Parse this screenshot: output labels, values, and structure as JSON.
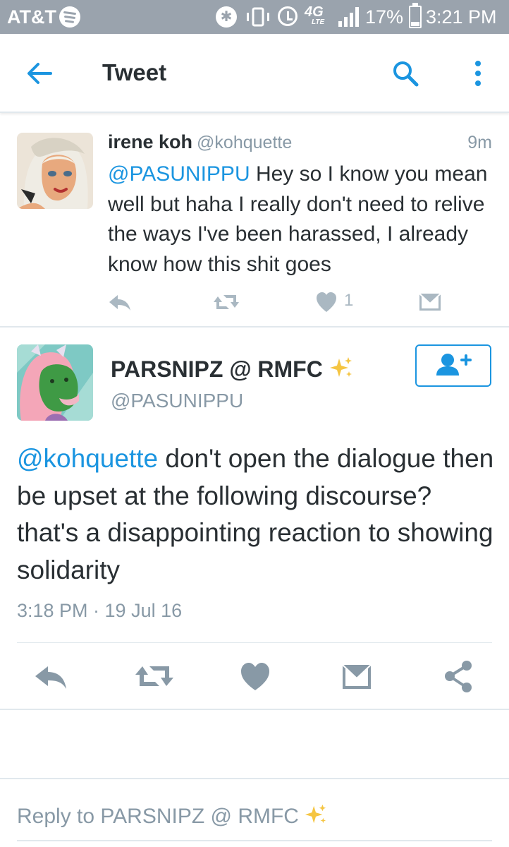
{
  "status_bar": {
    "carrier": "AT&T",
    "battery_percent": "17%",
    "time": "3:21 PM",
    "network": "4G",
    "network_sub": "LTE",
    "bluetooth_glyph": "✱"
  },
  "app_bar": {
    "title": "Tweet",
    "back_icon": "arrow-left-icon",
    "search_icon": "search-icon",
    "more_icon": "more-vertical-icon"
  },
  "reply_tweet": {
    "display_name": "irene koh",
    "handle": "@kohquette",
    "age": "9m",
    "mention": "@PASUNIPPU",
    "text": " Hey so I know you mean well but haha I really don't need to relive the ways I've been harassed, I already know how this shit goes",
    "like_count": "1"
  },
  "main_tweet": {
    "display_name": "PARSNIPZ @ RMFC",
    "handle": "@PASUNIPPU",
    "mention": "@kohquette",
    "text": " don't open the dialogue then be upset at the following discourse? that's a disappointing reaction to showing solidarity",
    "timestamp": "3:18 PM · 19 Jul 16",
    "follow_icon": "follow-user-icon"
  },
  "composer": {
    "placeholder": "Reply to PARSNIPZ @ RMFC"
  },
  "colors": {
    "accent": "#1b95e0",
    "icon_gray": "#aab8c2",
    "action_gray": "#8899a6",
    "status_bar": "#9aa3ad"
  }
}
